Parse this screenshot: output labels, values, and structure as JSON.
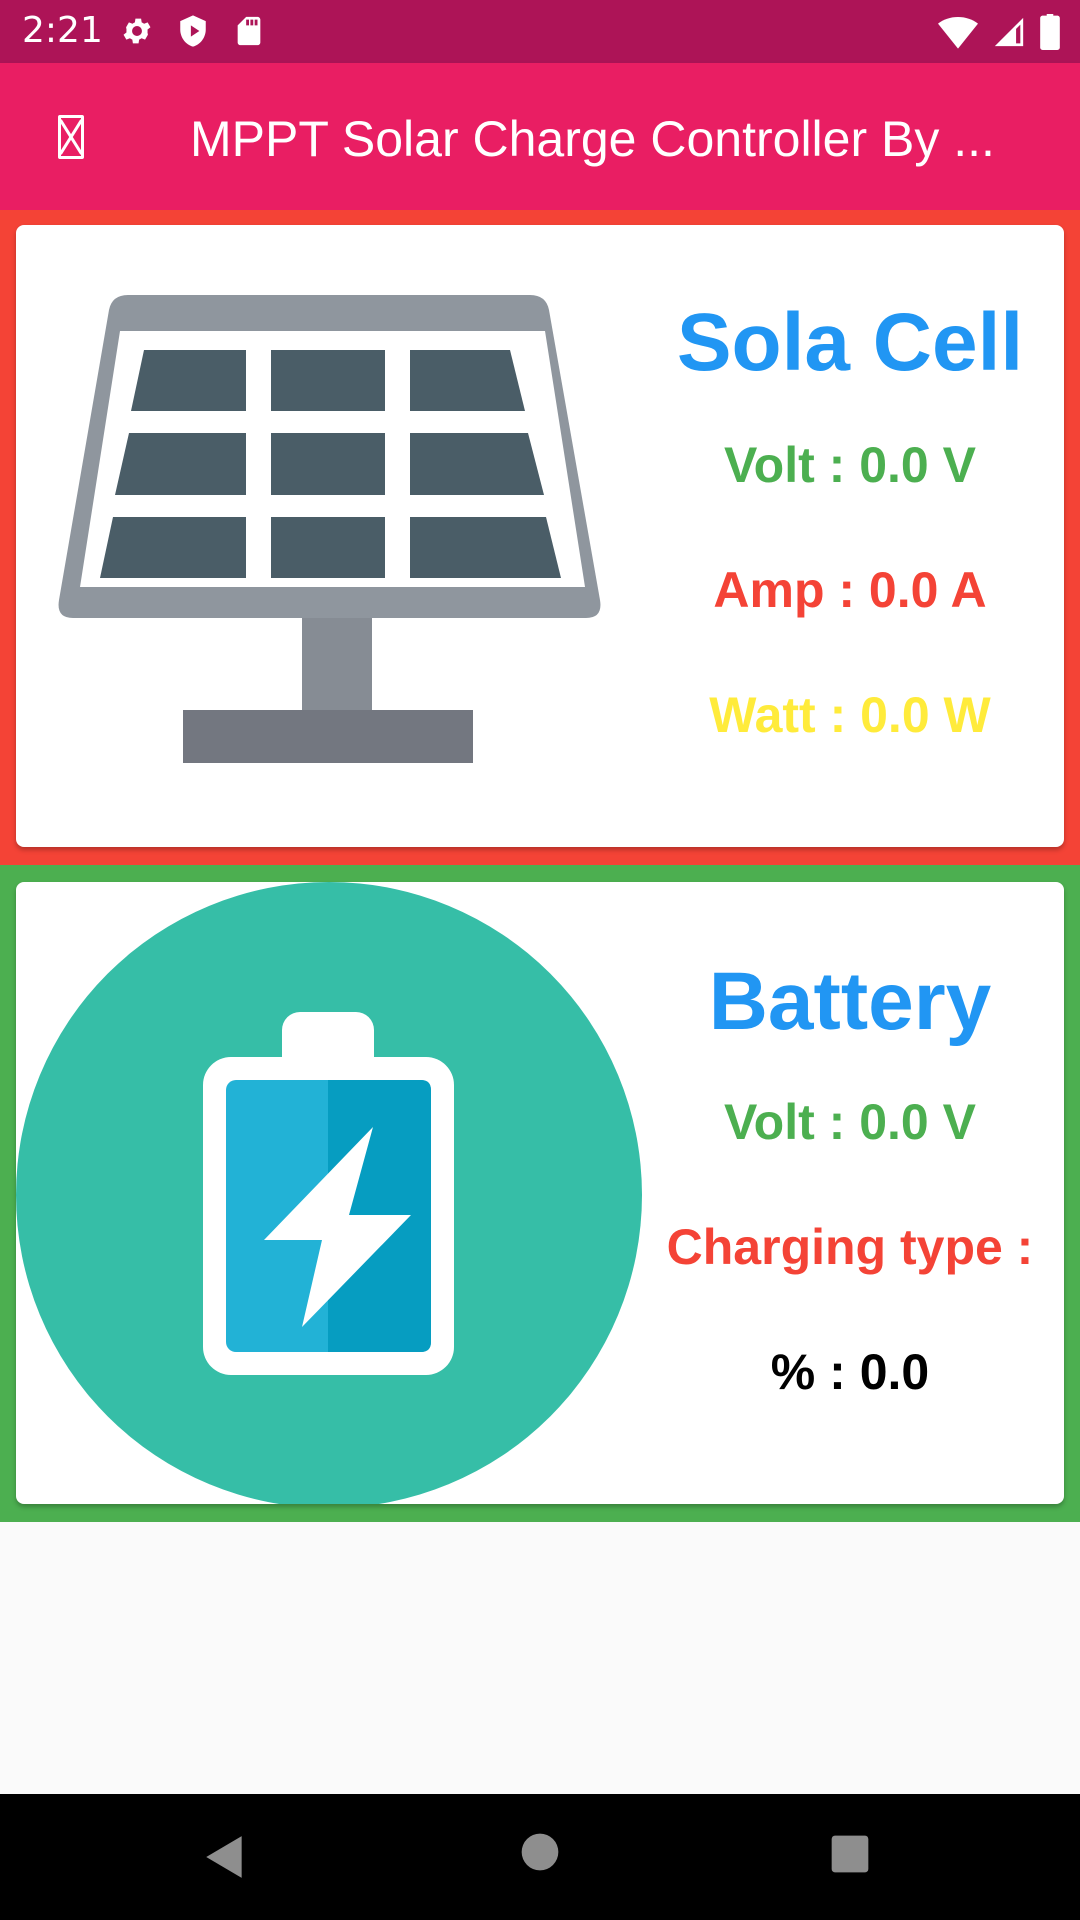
{
  "status_bar": {
    "time": "2:21",
    "icons_left": [
      "settings-icon",
      "shield-icon",
      "sd-card-icon"
    ],
    "icons_right": [
      "wifi-icon",
      "cell-signal-icon",
      "battery-icon"
    ]
  },
  "app_bar": {
    "nav_icon": "missing-glyph-icon",
    "title": "MPPT Solar Charge Controller By ..."
  },
  "solar_cell": {
    "title": "Sola Cell",
    "volt": "Volt : 0.0 V",
    "amp": "Amp : 0.0 A",
    "watt": "Watt : 0.0 W",
    "image_icon": "solar-panel-icon",
    "colors": {
      "panel_bg": "#f44336",
      "volt": "#4caf50",
      "amp": "#f44336",
      "watt": "#ffeb3b"
    }
  },
  "battery": {
    "title": "Battery",
    "volt": "Volt : 0.0 V",
    "charging_type": "Charging type :",
    "percent": "% : 0.0",
    "image_icon": "battery-charging-icon",
    "colors": {
      "panel_bg": "#4caf50",
      "volt": "#4caf50",
      "charging_type": "#f44336",
      "percent": "#000000"
    }
  },
  "nav_bar": {
    "back_icon": "back-icon",
    "home_icon": "home-icon",
    "recents_icon": "recents-icon"
  },
  "colors": {
    "status_bar": "#ad1457",
    "app_bar": "#e91e63",
    "title_blue": "#2196f3",
    "background": "#fafafa"
  }
}
